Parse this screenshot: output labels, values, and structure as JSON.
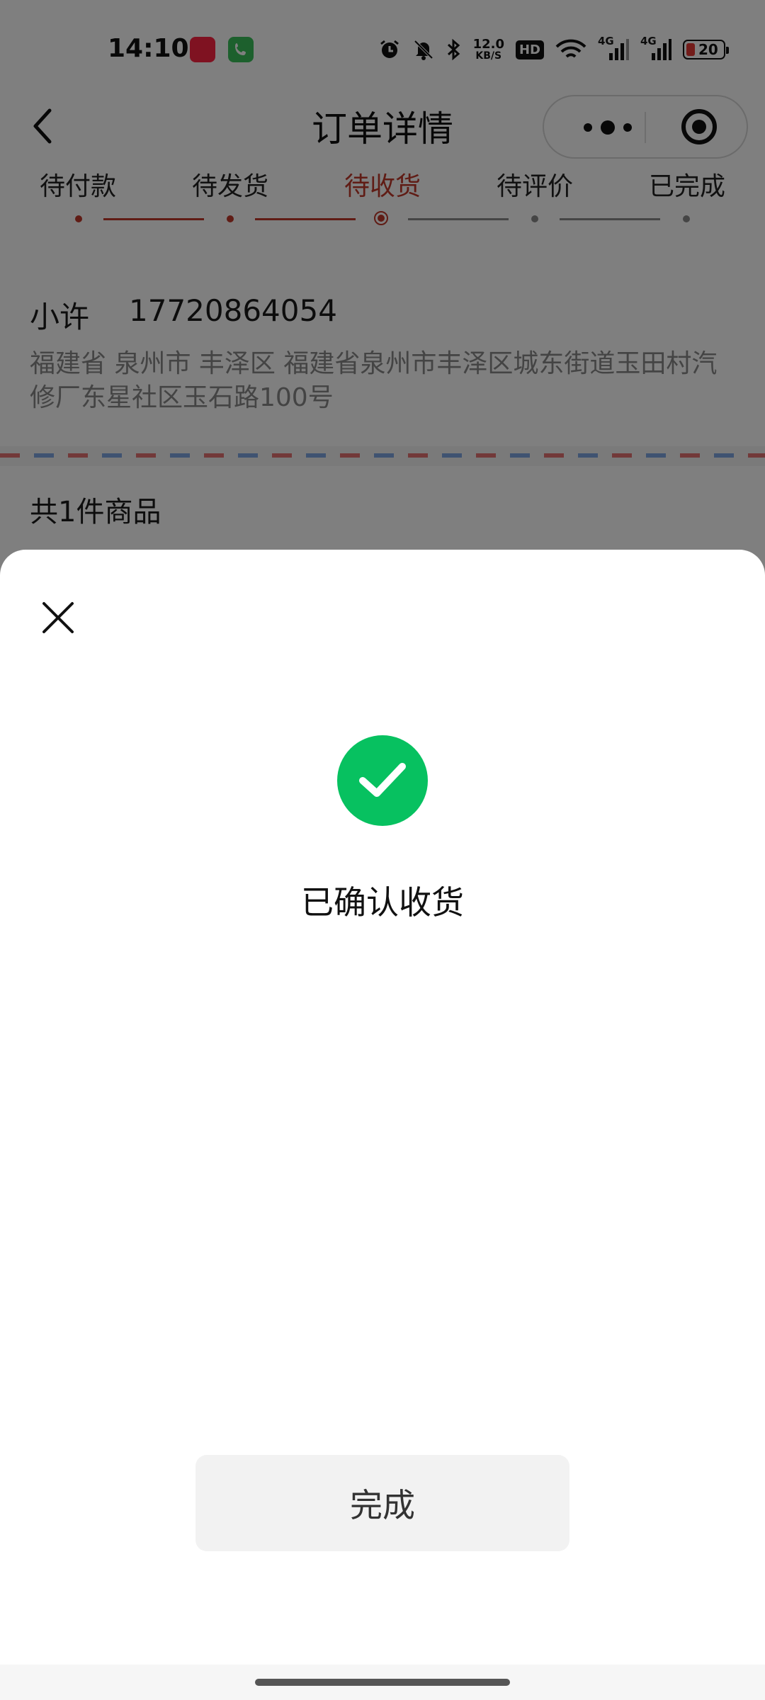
{
  "status_bar": {
    "time": "14:10",
    "speed_value": "12.0",
    "speed_unit": "KB/S",
    "hd_label": "HD",
    "network_1": "4G",
    "network_2": "4G",
    "battery_level": "20",
    "icons": [
      "xiaohongshu-app-icon",
      "phone-app-icon",
      "alarm-icon",
      "mute-icon",
      "bluetooth-icon",
      "hd-icon",
      "wifi-icon",
      "signal-icon",
      "signal-icon",
      "battery-icon"
    ]
  },
  "nav": {
    "title": "订单详情",
    "back_icon": "chevron-left-icon",
    "menu_icon": "more-dots-icon",
    "target_icon": "target-icon"
  },
  "steps": {
    "items": [
      {
        "label": "待付款",
        "state": "done"
      },
      {
        "label": "待发货",
        "state": "done"
      },
      {
        "label": "待收货",
        "state": "current"
      },
      {
        "label": "待评价",
        "state": "todo"
      },
      {
        "label": "已完成",
        "state": "todo"
      }
    ],
    "active_color": "#c0392b",
    "inactive_color": "#8a8a8a"
  },
  "address": {
    "name": "小许",
    "phone": "17720864054",
    "detail": "福建省 泉州市 丰泽区 福建省泉州市丰泽区城东街道玉田村汽修厂东星社区玉石路100号"
  },
  "goods": {
    "count_text": "共1件商品"
  },
  "sheet": {
    "close_icon": "close-icon",
    "success_icon": "check-circle-icon",
    "success_color": "#07c160",
    "result_text": "已确认收货",
    "done_label": "完成"
  }
}
